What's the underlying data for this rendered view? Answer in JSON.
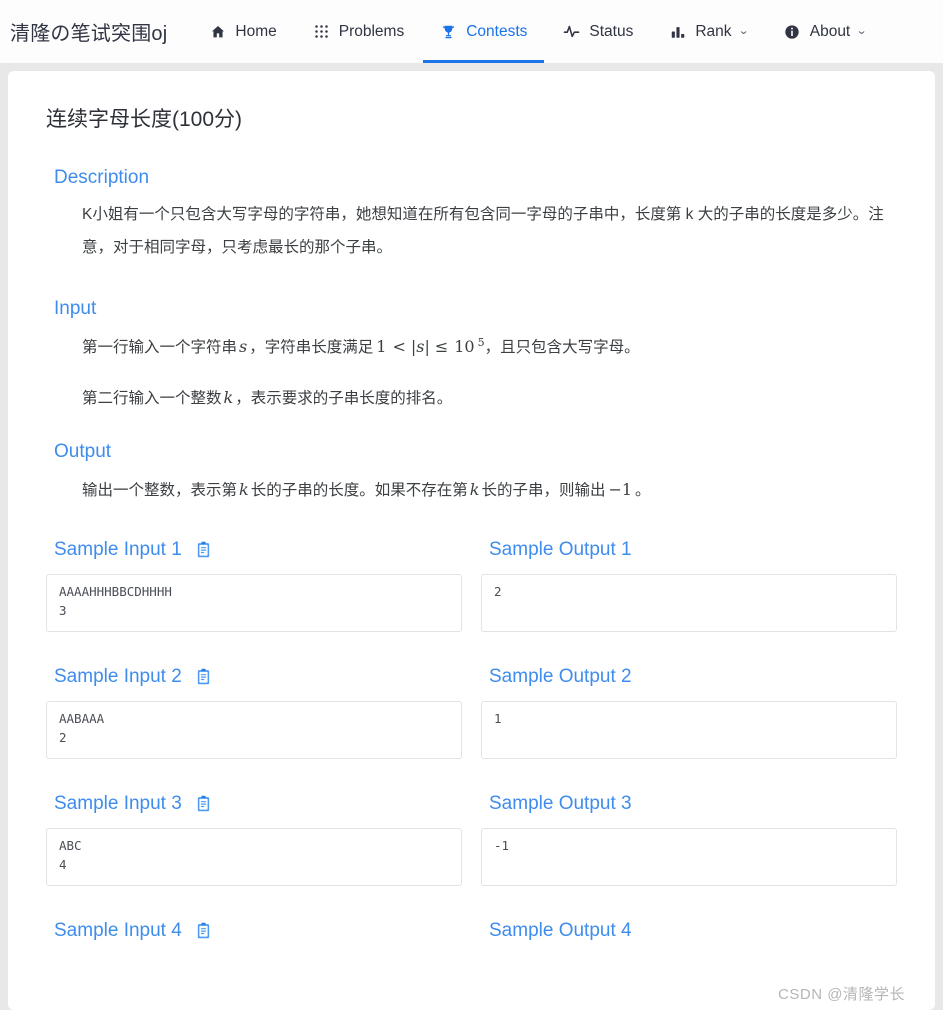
{
  "navbar": {
    "brand": "清隆の笔试突围oj",
    "items": [
      {
        "label": "Home",
        "icon": "home-icon",
        "active": false,
        "caret": ""
      },
      {
        "label": "Problems",
        "icon": "grid-icon",
        "active": false,
        "caret": ""
      },
      {
        "label": "Contests",
        "icon": "trophy-icon",
        "active": true,
        "caret": ""
      },
      {
        "label": "Status",
        "icon": "activity-icon",
        "active": false,
        "caret": ""
      },
      {
        "label": "Rank",
        "icon": "bar-chart-icon",
        "active": false,
        "caret": "⌄"
      },
      {
        "label": "About",
        "icon": "info-icon",
        "active": false,
        "caret": "⌄"
      }
    ],
    "accent_color": "#1a73e8",
    "text_color": "#313543"
  },
  "problem": {
    "title": "连续字母长度(100分)",
    "sections": {
      "description_heading": "Description",
      "description_text": "K小姐有一个只包含大写字母的字符串，她想知道在所有包含同一字母的子串中，长度第 k 大的子串的长度是多少。注意，对于相同字母，只考虑最长的那个子串。",
      "input_heading": "Input",
      "input_line1_a": "第一行输入一个字符串",
      "input_line1_var": "s",
      "input_line1_b": "，字符串长度满足",
      "input_line1_math_1": "1",
      "input_line1_math_lt": "<",
      "input_line1_math_abs": "|s|",
      "input_line1_math_le": "≤",
      "input_line1_math_10": "10",
      "input_line1_math_exp": "5",
      "input_line1_c": "，且只包含大写字母。",
      "input_line2_a": "第二行输入一个整数",
      "input_line2_var": "k",
      "input_line2_b": "，表示要求的子串长度的排名。",
      "output_heading": "Output",
      "output_line_a": "输出一个整数，表示第",
      "output_line_var1": "k",
      "output_line_b": "长的子串的长度。如果不存在第",
      "output_line_var2": "k",
      "output_line_c": "长的子串，则输出",
      "output_line_val": "−1",
      "output_line_d": "。"
    },
    "heading_color": "#3e8ced"
  },
  "samples": [
    {
      "input_label": "Sample Input 1",
      "input_text": "AAAAHHHBBCDHHHH\n3",
      "output_label": "Sample Output 1",
      "output_text": "2",
      "copy_icon": "clipboard-copy-icon"
    },
    {
      "input_label": "Sample Input 2",
      "input_text": "AABAAA\n2",
      "output_label": "Sample Output 2",
      "output_text": "1",
      "copy_icon": "clipboard-copy-icon"
    },
    {
      "input_label": "Sample Input 3",
      "input_text": "ABC\n4",
      "output_label": "Sample Output 3",
      "output_text": "-1",
      "copy_icon": "clipboard-copy-icon"
    },
    {
      "input_label": "Sample Input 4",
      "input_text": "",
      "output_label": "Sample Output 4",
      "output_text": "",
      "copy_icon": "clipboard-copy-icon"
    }
  ],
  "watermark": "CSDN @清隆学长"
}
